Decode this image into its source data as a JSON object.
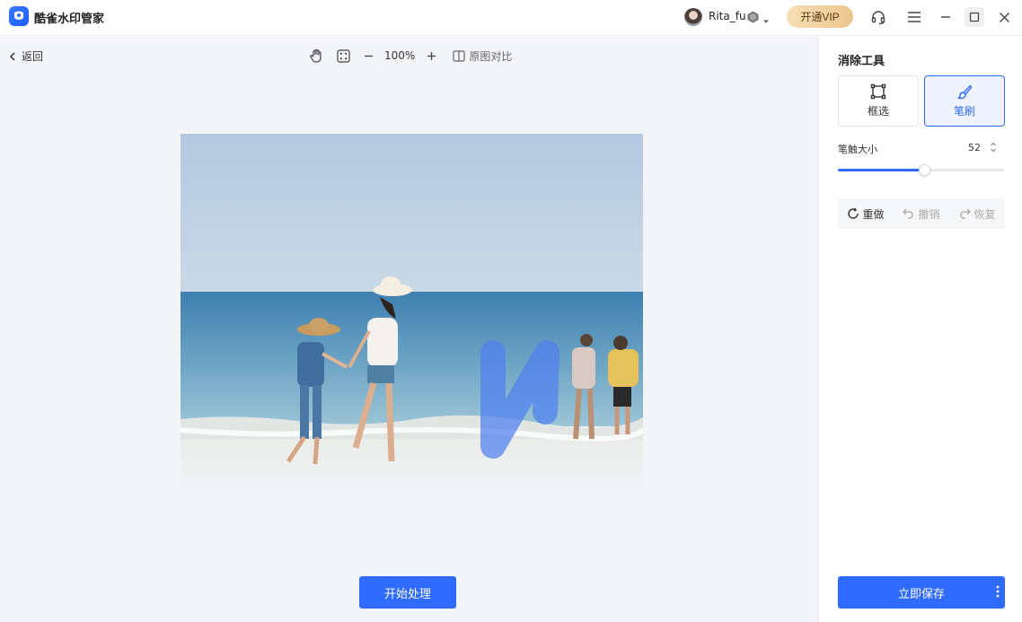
{
  "app": {
    "title": "酷雀水印管家"
  },
  "user": {
    "name": "Rita_fu"
  },
  "header": {
    "vip_label": "开通VIP"
  },
  "toolbar": {
    "back_label": "返回",
    "zoom_level": "100%",
    "compare_label": "原图对比"
  },
  "canvas": {
    "start_label": "开始处理"
  },
  "panel": {
    "title": "消除工具",
    "tools": [
      {
        "label": "框选",
        "active": false
      },
      {
        "label": "笔刷",
        "active": true
      }
    ],
    "brush_size_label": "笔触大小",
    "brush_size_value": "52",
    "brush_slider_fraction": 0.52,
    "history": {
      "redo_all_label": "重做",
      "undo_label": "撤销",
      "restore_label": "恢复"
    },
    "save_label": "立即保存"
  },
  "colors": {
    "accent": "#2f6bff",
    "vip_gold": "#ecc58e",
    "canvas_bg": "#f2f4f7"
  }
}
